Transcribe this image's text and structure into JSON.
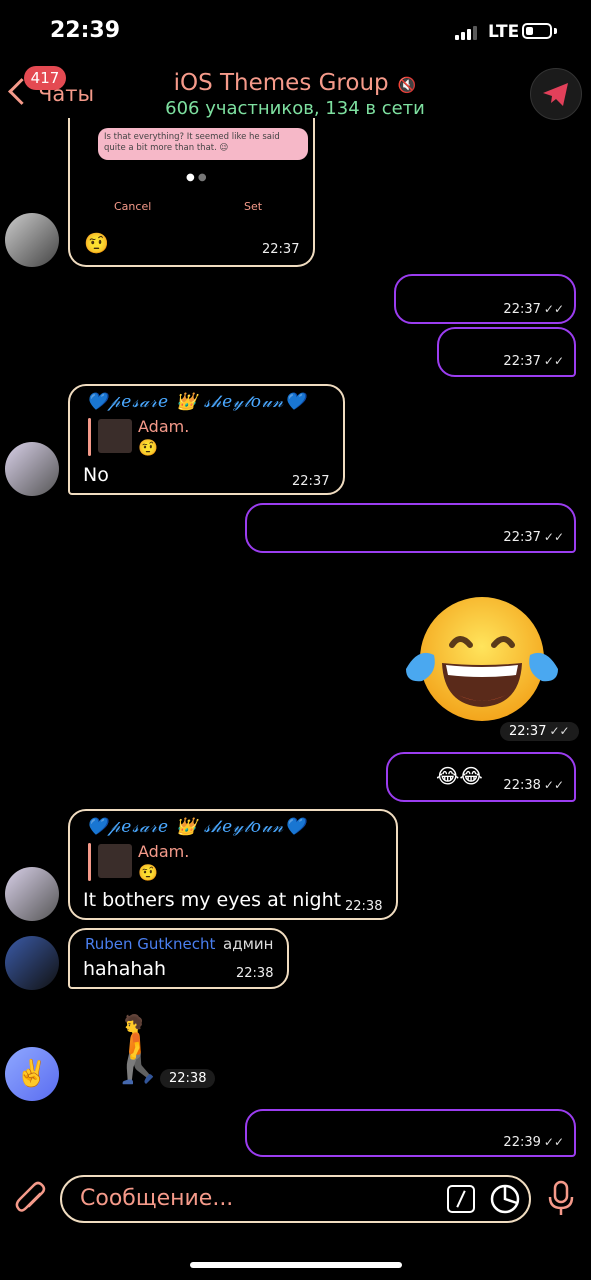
{
  "status_bar": {
    "time": "22:39",
    "network": "LTE"
  },
  "header": {
    "back_label": "Чаты",
    "unread_badge": "417",
    "title": "iOS Themes Group",
    "subtitle": "606 участников, 134 в сети"
  },
  "messages": {
    "m1": {
      "screenshot_text": "Is that everything? It seemed like he said quite a bit more than that. 😉",
      "cancel": "Cancel",
      "set": "Set",
      "emoji": "🤨",
      "time": "22:37"
    },
    "m2": {
      "time": "22:37"
    },
    "m3": {
      "time": "22:37"
    },
    "m4": {
      "sender": "💙𝓅𝑒𝓈𝒶𝓇𝑒 👑 𝓈𝒽𝑒𝓎𝓉𝑜𝓊𝓃💙",
      "reply_name": "Adam.",
      "reply_emoji": "🤨",
      "text": "No",
      "time": "22:37"
    },
    "m5": {
      "time": "22:37"
    },
    "m6": {
      "time": "22:37"
    },
    "m7": {
      "text": "😂😂",
      "time": "22:38"
    },
    "m8": {
      "sender": "💙𝓅𝑒𝓈𝒶𝓇𝑒 👑 𝓈𝒽𝑒𝓎𝓉𝑜𝓊𝓃💙",
      "reply_name": "Adam.",
      "reply_emoji": "🤨",
      "text": "It bothers my eyes at night",
      "time": "22:38"
    },
    "m9": {
      "sender": "Ruben Gutknecht",
      "role": "админ",
      "text": "hahahah",
      "time": "22:38"
    },
    "m10": {
      "time": "22:38"
    },
    "m11": {
      "time": "22:39"
    }
  },
  "input": {
    "placeholder": "Сообщение..."
  },
  "colors": {
    "accent": "#f59a8a",
    "incoming_border": "#f0dcc0",
    "outgoing_border": "#9b3df0",
    "online": "#7ee0a0",
    "admin_name": "#4a7ff0"
  }
}
